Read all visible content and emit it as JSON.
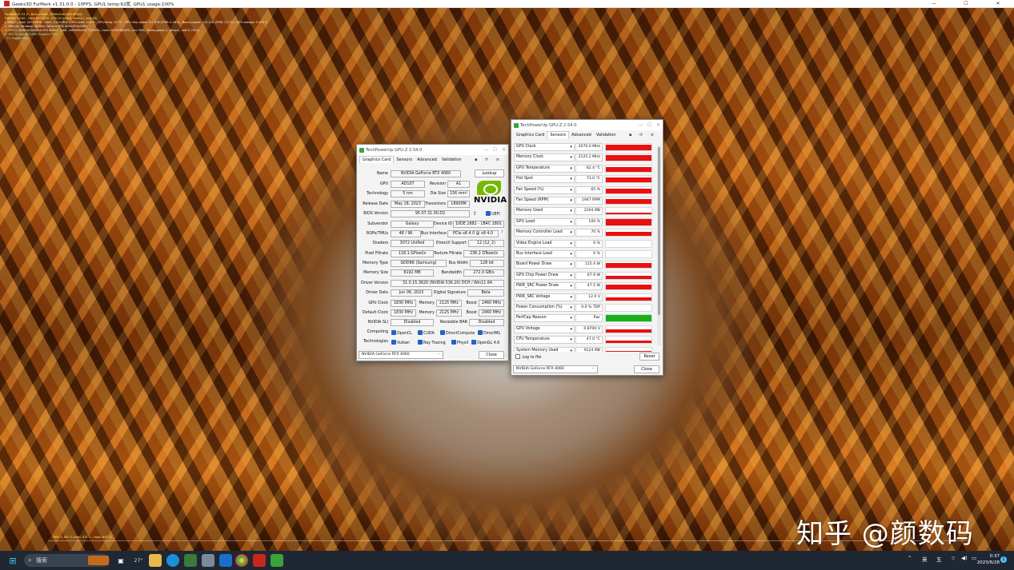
{
  "furmark": {
    "title": "Geeks3D FurMark v1.31.0.0 - 10FPS, GPU1 temp:62度, GPU1 usage:100%",
    "window_controls": [
      "—",
      "☐",
      "✕"
    ],
    "hud_lines": [
      "FurMark v1.31.0 - Burn-in test, 3840x2160 (0X MSAA)",
      "Frames:12740 - time:00:05:03 - FPS:10 (min:8, max:11, avg:10)",
      "[ GPU-Z ] core: 2070 MHz - mem: 2125 MHz - GPU load: 100 % - GPU temp: 62 °C - GPU chip power: 67.9 W (PPW: 0.283) - Board power: 115.4 W (PPW: 0.173) - GPU voltage: 0.870 V",
      "> OpenGL renderer: NVIDIA GeForce RTX 4060/PCIe/SSE2",
      "> GPU 1 (NVIDIA GeForce RTX 4060) - core: 2085MHz/62 °C/100%, mem: 8192MB/26%, fan: 65%, limits(power:1, temp:0, volt:0, OV:0)",
      "> GPU 2 (Intel(R) UHD Graphics 770)",
      "- F1: toggle help"
    ],
    "footer": "GPU 1: 62° C (min: 43° C - max: 64° C)"
  },
  "watermark": "知乎 @颜数码",
  "gpuz_main": {
    "title": "TechPowerUp GPU-Z 2.54.0",
    "tabs": [
      "Graphics Card",
      "Sensors",
      "Advanced",
      "Validation"
    ],
    "tab_icons": "▪ ⟳ ≡",
    "name_label": "Name",
    "name": "NVIDIA GeForce RTX 4060",
    "lookup": "Lookup",
    "gpu_label": "GPU",
    "gpu": "AD107",
    "revision_label": "Revision",
    "revision": "A1",
    "tech_label": "Technology",
    "tech": "5 nm",
    "die_label": "Die Size",
    "die": "156 mm²",
    "release_label": "Release Date",
    "release": "May 18, 2023",
    "trans_label": "Transistors",
    "trans": "18900M",
    "bios_label": "BIOS Version",
    "bios": "95.07.31.00.D2",
    "uefi": "UEFI",
    "subvendor_label": "Subvendor",
    "subvendor": "Galaxy",
    "devid_label": "Device ID",
    "devid": "10DE 2882 - 1B4C 1801",
    "rops_label": "ROPs/TMUs",
    "rops": "48 / 96",
    "bus_label": "Bus Interface",
    "bus": "PCIe x8 4.0 @ x8 4.0",
    "bus_q": "?",
    "shaders_label": "Shaders",
    "shaders": "3072 Unified",
    "dx_label": "DirectX Support",
    "dx": "12 (12_2)",
    "pixel_label": "Pixel Fillrate",
    "pixel": "118.1 GPixel/s",
    "tex_label": "Texture Fillrate",
    "tex": "236.2 GTexel/s",
    "memtype_label": "Memory Type",
    "memtype": "GDDR6 (Samsung)",
    "buswidth_label": "Bus Width",
    "buswidth": "128 bit",
    "memsize_label": "Memory Size",
    "memsize": "8192 MB",
    "bandwidth_label": "Bandwidth",
    "bandwidth": "272.0 GB/s",
    "driver_label": "Driver Version",
    "driver": "31.0.15.3620 (NVIDIA 536.20) DCH / Win11 64",
    "driverdate_label": "Driver Date",
    "driverdate": "Jun 06, 2023",
    "digsig_label": "Digital Signature",
    "digsig": "Beta",
    "gpuclock_label": "GPU Clock",
    "gpuclock": "1830 MHz",
    "mem1_label": "Memory",
    "mem1": "2125 MHz",
    "boost1_label": "Boost",
    "boost1": "2460 MHz",
    "defclock_label": "Default Clock",
    "defclock": "1830 MHz",
    "mem2_label": "Memory",
    "mem2": "2125 MHz",
    "boost2_label": "Boost",
    "boost2": "2460 MHz",
    "sli_label": "NVIDIA SLI",
    "sli": "Disabled",
    "rebar_label": "Resizable BAR",
    "rebar": "Disabled",
    "computing_label": "Computing",
    "computing": [
      "OpenCL",
      "CUDA",
      "DirectCompute",
      "DirectML"
    ],
    "tech2_label": "Technologies",
    "technologies": [
      "Vulkan",
      "Ray Tracing",
      "PhysX",
      "OpenGL 4.6"
    ],
    "nvidia_logo": "NVIDIA",
    "device_select": "NVIDIA GeForce RTX 4060",
    "close": "Close"
  },
  "gpuz_sensors": {
    "title": "TechPowerUp GPU-Z 2.54.0",
    "tabs": [
      "Graphics Card",
      "Sensors",
      "Advanced",
      "Validation"
    ],
    "tab_icons": "▪ ⟳ ≡",
    "rows": [
      {
        "name": "GPU Clock",
        "value": "2070.0 MHz",
        "level": 0.85,
        "color": "#e81010"
      },
      {
        "name": "Memory Clock",
        "value": "2125.2 MHz",
        "level": 0.9,
        "color": "#e81010"
      },
      {
        "name": "GPU Temperature",
        "value": "62.4 °C",
        "level": 0.75,
        "color": "#e81010"
      },
      {
        "name": "Hot Spot",
        "value": "73.0 °C",
        "level": 0.75,
        "color": "#e81010"
      },
      {
        "name": "Fan Speed (%)",
        "value": "65 %",
        "level": 0.7,
        "color": "#e81010"
      },
      {
        "name": "Fan Speed (RPM)",
        "value": "1947 RPM",
        "level": 0.7,
        "color": "#e81010"
      },
      {
        "name": "Memory Used",
        "value": "2204 MB",
        "level": 0.3,
        "color": "#e81010"
      },
      {
        "name": "GPU Load",
        "value": "100 %",
        "level": 0.95,
        "color": "#e81010"
      },
      {
        "name": "Memory Controller Load",
        "value": "70 %",
        "level": 0.65,
        "color": "#e81010"
      },
      {
        "name": "Video Engine Load",
        "value": "0 %",
        "level": 0,
        "color": "#e81010"
      },
      {
        "name": "Bus Interface Load",
        "value": "0 %",
        "level": 0,
        "color": "#e81010"
      },
      {
        "name": "Board Power Draw",
        "value": "115.4 W",
        "level": 0.85,
        "color": "#e81010"
      },
      {
        "name": "GPU Chip Power Draw",
        "value": "67.9 W",
        "level": 0.5,
        "color": "#e81010"
      },
      {
        "name": "PWR_SRC Power Draw",
        "value": "47.5 W",
        "level": 0.75,
        "color": "#e81010"
      },
      {
        "name": "PWR_SRC Voltage",
        "value": "12.0 V",
        "level": 0.45,
        "color": "#e81010"
      },
      {
        "name": "Power Consumption (%)",
        "value": "0.0 % TDP",
        "level": 0,
        "color": "#e81010"
      },
      {
        "name": "PerfCap Reason",
        "value": "Pwr",
        "level": 1,
        "color": "#19b019"
      },
      {
        "name": "GPU Voltage",
        "value": "0.8700 V",
        "level": 0.45,
        "color": "#e81010"
      },
      {
        "name": "CPU Temperature",
        "value": "47.0 °C",
        "level": 0.45,
        "color": "#e81010"
      },
      {
        "name": "System Memory Used",
        "value": "9124 MB",
        "level": 0.4,
        "color": "#e81010"
      }
    ],
    "log_label": "Log to file",
    "reset": "Reset",
    "device_select": "NVIDIA GeForce RTX 4060",
    "close": "Close"
  },
  "taskbar": {
    "search": "搜索",
    "weather": "27°",
    "tray_lang": "英",
    "tray_ime": "五",
    "time": "0:37",
    "date": "2023/6/28",
    "notif": "1"
  }
}
